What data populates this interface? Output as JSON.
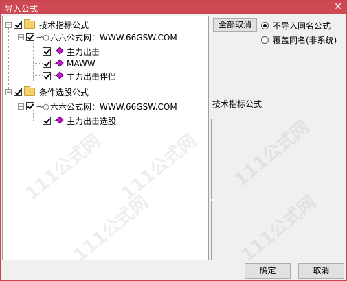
{
  "window": {
    "title": "导入公式",
    "close_glyph": "✕"
  },
  "tree": {
    "groups": [
      {
        "label": "技术指标公式",
        "source": "六六公式网：WWW.66GSW.COM",
        "items": [
          "主力出击",
          "MAWW",
          "主力出击伴侣"
        ]
      },
      {
        "label": "条件选股公式",
        "source": "六六公式网：WWW.66GSW.COM",
        "items": [
          "主力出击选股"
        ]
      }
    ]
  },
  "right": {
    "select_all_label": "全部取消",
    "radio_options": [
      {
        "label": "不导入同名公式",
        "selected": true
      },
      {
        "label": "覆盖同名(非系统)",
        "selected": false
      }
    ],
    "section_label": "技术指标公式"
  },
  "buttons": {
    "ok": "确定",
    "cancel": "取消"
  },
  "watermark_text": "111公式网",
  "colors": {
    "titlebar": "#cf4954",
    "folder": "#f5d36b",
    "formula_icon": "#c41ad7"
  }
}
